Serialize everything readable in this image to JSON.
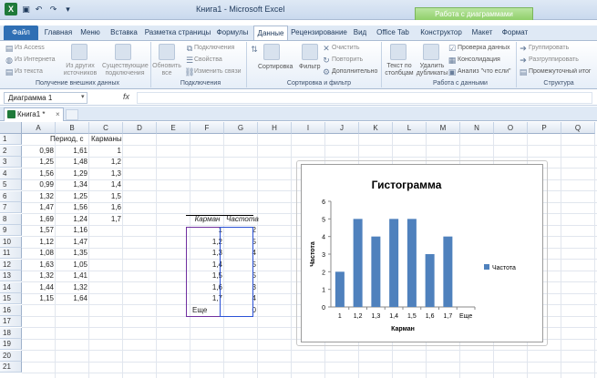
{
  "app": {
    "window_title": "Книга1  -  Microsoft Excel",
    "chart_tools_label": "Работа с диаграммами",
    "qat_undo": "↶",
    "qat_redo": "↷"
  },
  "tabs": [
    {
      "label": "Файл"
    },
    {
      "label": "Главная"
    },
    {
      "label": "Меню"
    },
    {
      "label": "Вставка"
    },
    {
      "label": "Разметка страницы"
    },
    {
      "label": "Формулы"
    },
    {
      "label": "Данные"
    },
    {
      "label": "Рецензирование"
    },
    {
      "label": "Вид"
    },
    {
      "label": "Office Tab"
    },
    {
      "label": "Конструктор"
    },
    {
      "label": "Макет"
    },
    {
      "label": "Формат"
    }
  ],
  "ribbon": {
    "ext_data": {
      "from_access": "Из Access",
      "from_web": "Из Интернета",
      "from_text": "Из текста",
      "from_other": "Из других источников",
      "existing": "Существующие подключения",
      "group": "Получение внешних данных"
    },
    "connections": {
      "refresh": "Обновить все",
      "connections": "Подключения",
      "properties": "Свойства",
      "edit_links": "Изменить связи",
      "group": "Подключения"
    },
    "sort_filter": {
      "sort": "Сортировка",
      "filter": "Фильтр",
      "clear": "Очистить",
      "reapply": "Повторить",
      "advanced": "Дополнительно",
      "group": "Сортировка и фильтр"
    },
    "data_tools": {
      "text_to_cols": "Текст по столбцам",
      "remove_dup": "Удалить дубликаты",
      "validation": "Проверка данных",
      "consolidate": "Консолидация",
      "whatif": "Анализ \"что если\"",
      "group": "Работа с данными"
    },
    "outline": {
      "group_btn": "Группировать",
      "ungroup_btn": "Разгруппировать",
      "subtotal": "Промежуточный итог",
      "group": "Структура"
    }
  },
  "formula_bar": {
    "name_box": "Диаграмма 1",
    "fx": "fx",
    "value": ""
  },
  "workbook_tab": "Книга1 *",
  "columns": [
    "A",
    "B",
    "C",
    "D",
    "E",
    "F",
    "G",
    "H",
    "I",
    "J",
    "K",
    "L",
    "M",
    "N",
    "O",
    "P",
    "Q"
  ],
  "rows": [
    "1",
    "2",
    "3",
    "4",
    "5",
    "6",
    "7",
    "8",
    "9",
    "10",
    "11",
    "12",
    "13",
    "14",
    "15",
    "16",
    "17",
    "18",
    "19",
    "20",
    "21"
  ],
  "cells": {
    "B1": "Период, с",
    "C1": "Карманы",
    "A2": "0,98",
    "B2": "1,61",
    "C2": "1",
    "A3": "1,25",
    "B3": "1,48",
    "C3": "1,2",
    "A4": "1,56",
    "B4": "1,29",
    "C4": "1,3",
    "A5": "0,99",
    "B5": "1,34",
    "C5": "1,4",
    "A6": "1,32",
    "B6": "1,25",
    "C6": "1,5",
    "A7": "1,47",
    "B7": "1,56",
    "C7": "1,6",
    "A8": "1,69",
    "B8": "1,24",
    "C8": "1,7",
    "A9": "1,57",
    "B9": "1,16",
    "A10": "1,12",
    "B10": "1,47",
    "A11": "1,08",
    "B11": "1,35",
    "A12": "1,63",
    "B12": "1,05",
    "A13": "1,32",
    "B13": "1,41",
    "A14": "1,44",
    "B14": "1,32",
    "A15": "1,15",
    "B15": "1,64",
    "F8": "Карман",
    "G8": "Частота",
    "F9": "1",
    "G9": "2",
    "F10": "1,2",
    "G10": "5",
    "F11": "1,3",
    "G11": "4",
    "F12": "1,4",
    "G12": "5",
    "F13": "1,5",
    "G13": "5",
    "F14": "1,6",
    "G14": "3",
    "F15": "1,7",
    "G15": "4",
    "F16": "Еще",
    "G16": "0"
  },
  "chart_data": {
    "type": "bar",
    "title": "Гистограмма",
    "xlabel": "Карман",
    "ylabel": "Частота",
    "categories": [
      "1",
      "1,2",
      "1,3",
      "1,4",
      "1,5",
      "1,6",
      "1,7",
      "Еще"
    ],
    "series": [
      {
        "name": "Частота",
        "values": [
          2,
          5,
          4,
          5,
          5,
          3,
          4,
          0
        ],
        "color": "#4f81bd"
      }
    ],
    "ylim": [
      0,
      6
    ],
    "yticks": [
      "0",
      "1",
      "2",
      "3",
      "4",
      "5",
      "6"
    ],
    "legend": "right",
    "grid": false
  }
}
